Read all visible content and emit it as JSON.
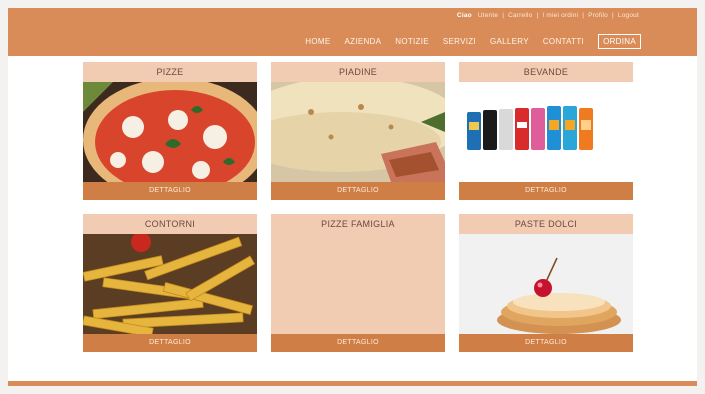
{
  "header": {
    "user_name": "Ciao",
    "user_links": [
      "Utente",
      "Carrello",
      "I miei ordini",
      "Profilo",
      "Logout"
    ],
    "nav": [
      "HOME",
      "AZIENDA",
      "NOTIZIE",
      "SERVIZI",
      "GALLERY",
      "CONTATTI",
      "ORDINA"
    ],
    "active_nav": "ORDINA",
    "brand_color": "#d98c58"
  },
  "categories": [
    {
      "title": "PIZZE",
      "detail": "DETTAGLIO"
    },
    {
      "title": "PIADINE",
      "detail": "DETTAGLIO"
    },
    {
      "title": "BEVANDE",
      "detail": "DETTAGLIO"
    },
    {
      "title": "CONTORNI",
      "detail": "DETTAGLIO"
    },
    {
      "title": "PIZZE FAMIGLIA",
      "detail": "DETTAGLIO"
    },
    {
      "title": "PASTE DOLCI",
      "detail": "DETTAGLIO"
    }
  ]
}
